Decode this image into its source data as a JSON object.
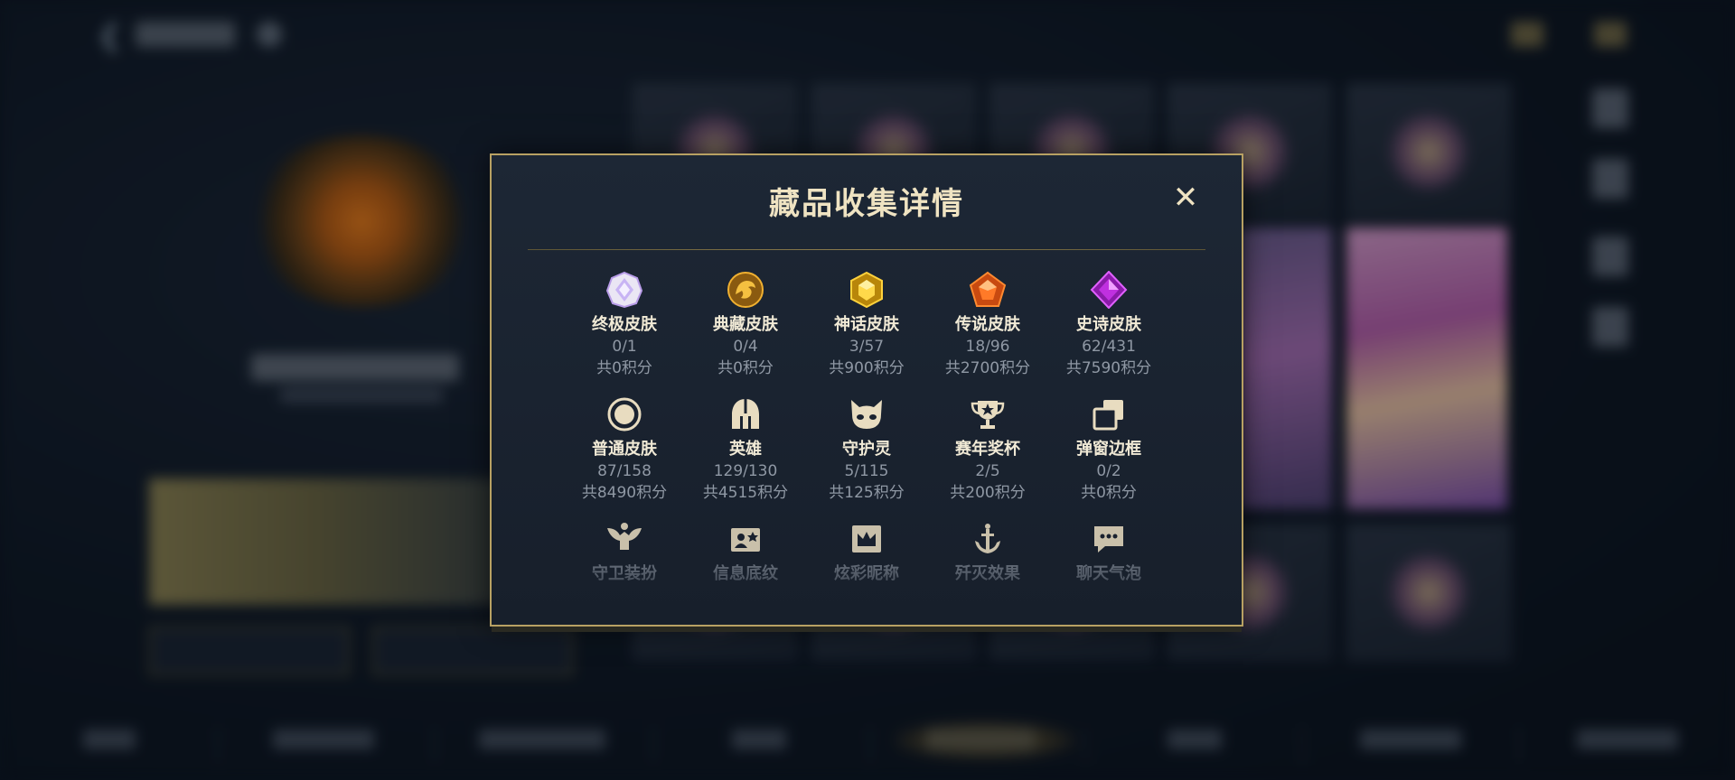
{
  "modal": {
    "title": "藏品收集详情",
    "close_label": "✕"
  },
  "collections": [
    {
      "icon": "ultimate-skin-icon",
      "name": "终极皮肤",
      "count": "0/1",
      "points": "共0积分"
    },
    {
      "icon": "collector-skin-icon",
      "name": "典藏皮肤",
      "count": "0/4",
      "points": "共0积分"
    },
    {
      "icon": "mythic-skin-icon",
      "name": "神话皮肤",
      "count": "3/57",
      "points": "共900积分"
    },
    {
      "icon": "legendary-skin-icon",
      "name": "传说皮肤",
      "count": "18/96",
      "points": "共2700积分"
    },
    {
      "icon": "epic-skin-icon",
      "name": "史诗皮肤",
      "count": "62/431",
      "points": "共7590积分"
    },
    {
      "icon": "standard-skin-icon",
      "name": "普通皮肤",
      "count": "87/158",
      "points": "共8490积分"
    },
    {
      "icon": "hero-helmet-icon",
      "name": "英雄",
      "count": "129/130",
      "points": "共4515积分"
    },
    {
      "icon": "guardian-spirit-icon",
      "name": "守护灵",
      "count": "5/115",
      "points": "共125积分"
    },
    {
      "icon": "season-trophy-icon",
      "name": "赛年奖杯",
      "count": "2/5",
      "points": "共200积分"
    },
    {
      "icon": "popup-frame-icon",
      "name": "弹窗边框",
      "count": "0/2",
      "points": "共0积分"
    },
    {
      "icon": "guardian-outfit-icon",
      "name": "守卫装扮",
      "count": "",
      "points": ""
    },
    {
      "icon": "info-background-icon",
      "name": "信息底纹",
      "count": "",
      "points": ""
    },
    {
      "icon": "colorful-nickname-icon",
      "name": "炫彩昵称",
      "count": "",
      "points": ""
    },
    {
      "icon": "elimination-effect-icon",
      "name": "歼灭效果",
      "count": "",
      "points": ""
    },
    {
      "icon": "chat-bubble-icon",
      "name": "聊天气泡",
      "count": "",
      "points": ""
    }
  ],
  "colors": {
    "gold_border": "#b8a163",
    "title": "#efe3c2",
    "label": "#f1ead6",
    "muted": "#8f98a4"
  }
}
